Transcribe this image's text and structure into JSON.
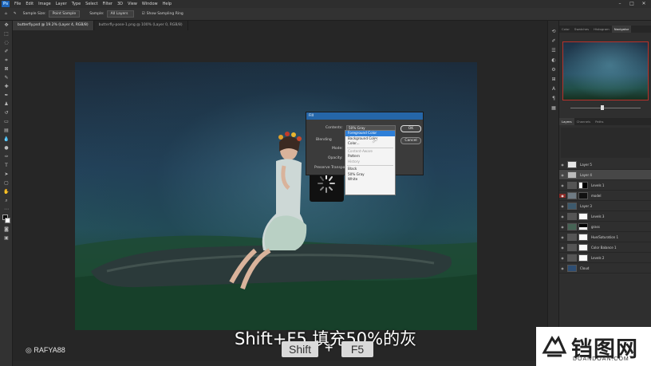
{
  "menubar": {
    "items": [
      "File",
      "Edit",
      "Image",
      "Layer",
      "Type",
      "Select",
      "Filter",
      "3D",
      "View",
      "Window",
      "Help"
    ]
  },
  "options": {
    "sample_size_label": "Sample Size:",
    "sample_size_value": "Point Sample",
    "sample_label": "Sample:",
    "sample_value": "All Layers",
    "show_ring_label": "Show Sampling Ring"
  },
  "tabs": [
    "butterfly.psd @ 19.2% (Layer 4, RGB/8)",
    "butterfly-pose-1.png @ 100% (Layer 0, RGB/8)"
  ],
  "panels": {
    "top_tabs": [
      "Color",
      "Swatches",
      "Histogram",
      "Navigator"
    ],
    "layer_tabs": [
      "Layers",
      "Channels",
      "Paths"
    ],
    "layers": [
      "Layer 5",
      "Layer 4",
      "Levels 1",
      "model",
      "Layer 3",
      "Levels 3",
      "grass",
      "Hue/Saturation 1",
      "Color Balance 1",
      "Levels 2",
      "Cloud"
    ]
  },
  "fill_dialog": {
    "title": "Fill",
    "contents_label": "Contents:",
    "contents_value": "50% Gray",
    "blending_label": "Blending",
    "mode_label": "Mode:",
    "opacity_label": "Opacity:",
    "preserve_label": "Preserve Transparency",
    "ok_label": "OK",
    "cancel_label": "Cancel",
    "options_group1": [
      "Foreground Color",
      "Background Color",
      "Color..."
    ],
    "options_group2": [
      "Content-Aware",
      "Pattern",
      "History"
    ],
    "options_group3": [
      "Black",
      "50% Gray",
      "White"
    ]
  },
  "overlay": {
    "subtitle": "Shift+F5 填充50%的灰",
    "key1": "Shift",
    "plus": "+",
    "key2": "F5",
    "ig_handle": "RAFYA88"
  },
  "brand": {
    "name": "铛图网",
    "url": "DOANDOAN.COM"
  },
  "colors": {
    "accent_blue": "#2566a8",
    "highlight": "#2e7fd8",
    "nav_frame": "#b8322b"
  }
}
